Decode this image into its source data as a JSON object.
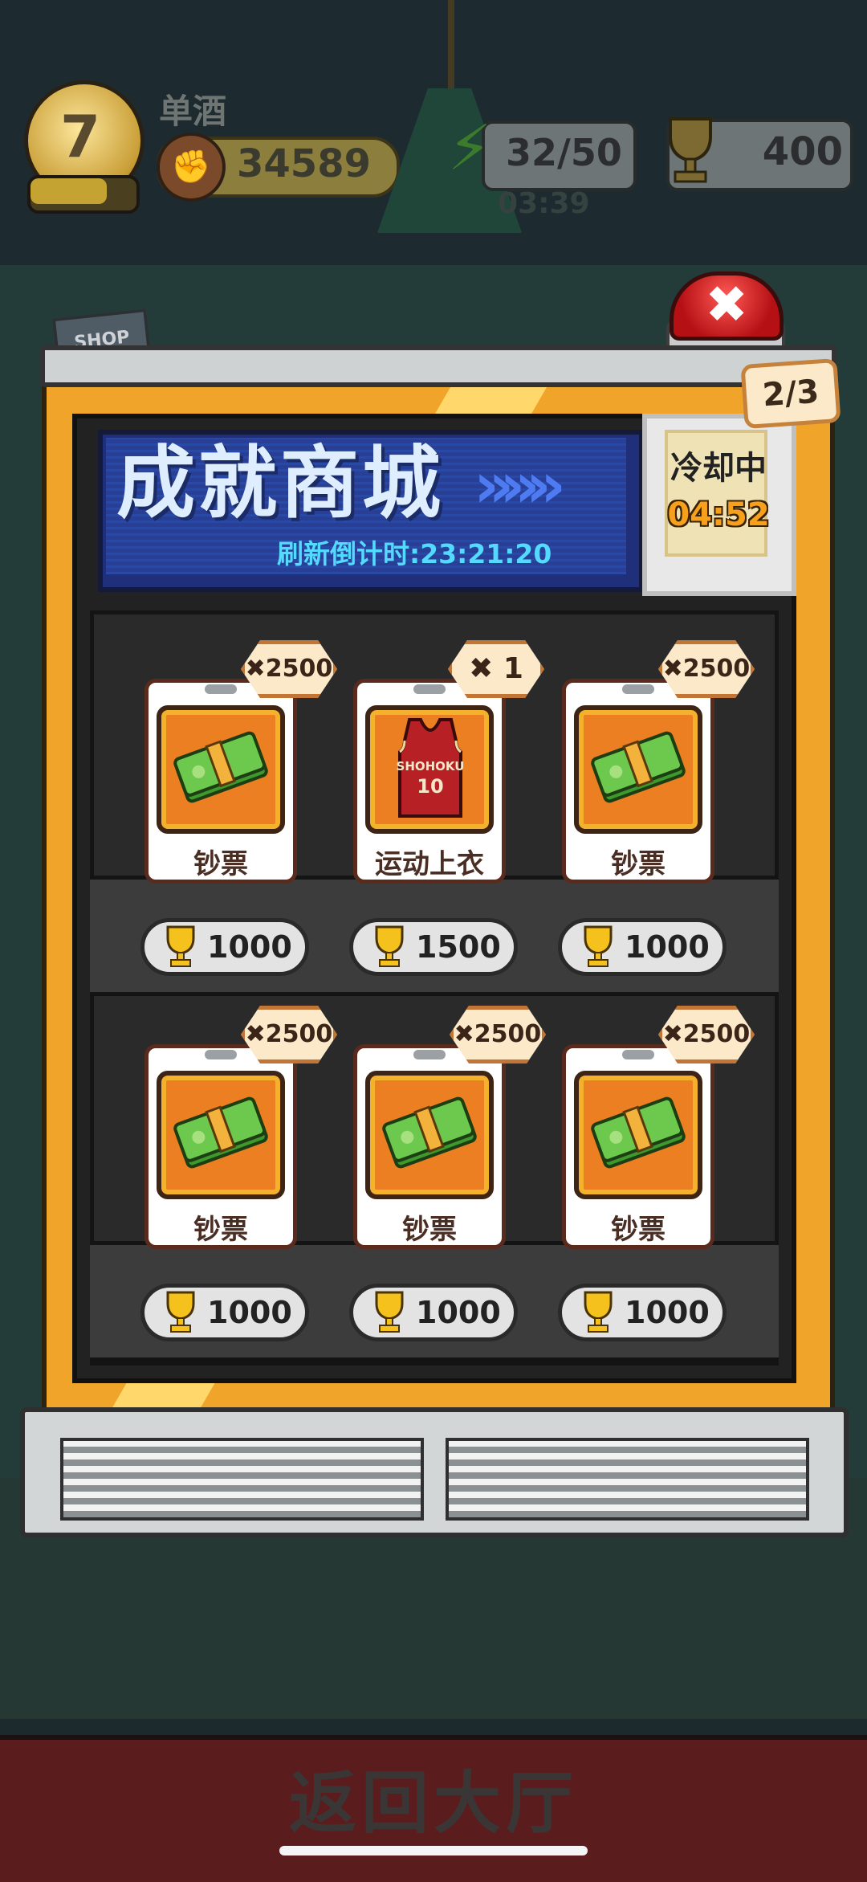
{
  "hud": {
    "level": "7",
    "player_name": "单酒",
    "power": "34589",
    "energy": "32/50",
    "energy_timer": "03:39",
    "trophies": "400"
  },
  "shop": {
    "title": "成就商城",
    "arrows": "»»»",
    "refresh_countdown": "刷新倒计时:23:21:20",
    "cooldown_label": "冷却中",
    "cooldown_timer": "04:52",
    "page": "2/3",
    "close_symbol": "✖",
    "shop_sign": "SHOP"
  },
  "items": [
    {
      "name": "钞票",
      "qty": "✖2500",
      "price": "1000",
      "icon": "cash-stack-icon"
    },
    {
      "name": "运动上衣",
      "qty": "✖ 1",
      "price": "1500",
      "icon": "jersey-icon",
      "jersey_text": "SHOHOKU",
      "jersey_number": "10"
    },
    {
      "name": "钞票",
      "qty": "✖2500",
      "price": "1000",
      "icon": "cash-stack-icon"
    },
    {
      "name": "钞票",
      "qty": "✖2500",
      "price": "1000",
      "icon": "cash-stack-icon"
    },
    {
      "name": "钞票",
      "qty": "✖2500",
      "price": "1000",
      "icon": "cash-stack-icon"
    },
    {
      "name": "钞票",
      "qty": "✖2500",
      "price": "1000",
      "icon": "cash-stack-icon"
    }
  ],
  "footer": {
    "back_to_lobby": "返回大厅"
  },
  "colors": {
    "machine_orange": "#f0a42a",
    "title_blue": "#2949a6",
    "countdown_cyan": "#54d9ff",
    "cooldown_orange": "#f6a01c",
    "close_red": "#d7191c"
  }
}
